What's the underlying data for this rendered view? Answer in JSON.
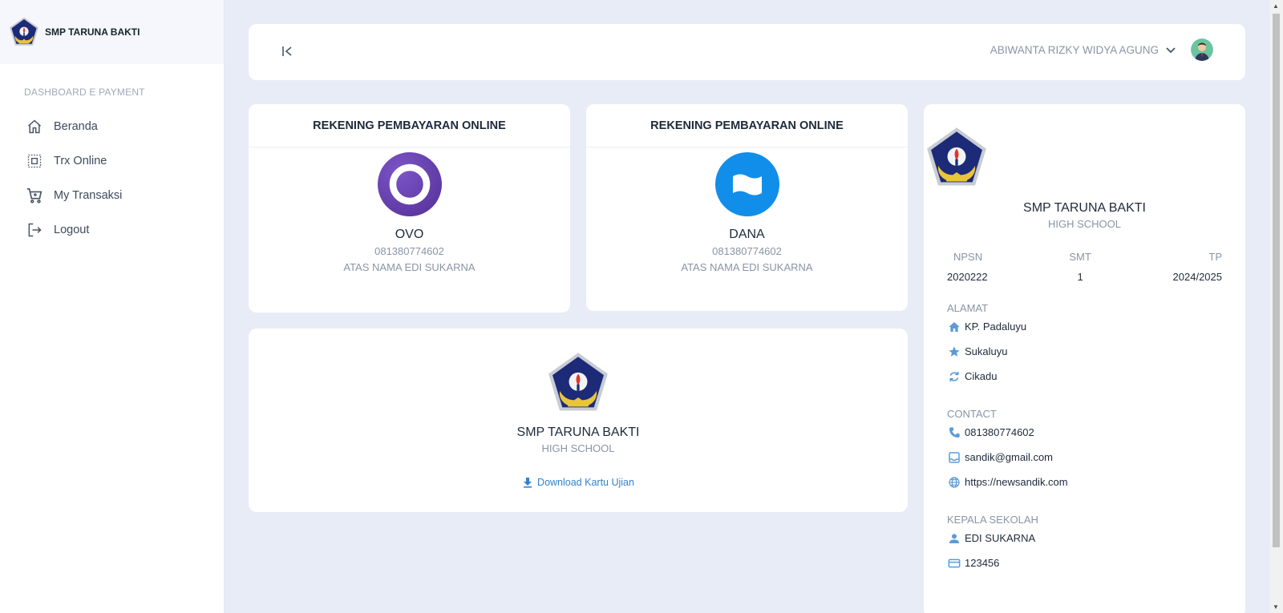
{
  "sidebar": {
    "brand": "SMP TARUNA BAKTI",
    "heading": "DASHBOARD E PAYMENT",
    "items": [
      {
        "label": "Beranda",
        "icon": "home-icon"
      },
      {
        "label": "Trx Online",
        "icon": "scan-icon"
      },
      {
        "label": "My Transaksi",
        "icon": "cart-icon"
      },
      {
        "label": "Logout",
        "icon": "logout-icon"
      }
    ]
  },
  "topbar": {
    "user_name": "ABIWANTA RIZKY WIDYA AGUNG",
    "collapse_icon": "collapse-sidebar-icon"
  },
  "payments": [
    {
      "title": "REKENING PEMBAYARAN ONLINE",
      "name": "OVO",
      "number": "081380774602",
      "holder": "ATAS NAMA EDI SUKARNA",
      "color": "#5f3aa4"
    },
    {
      "title": "REKENING PEMBAYARAN ONLINE",
      "name": "DANA",
      "number": "081380774602",
      "holder": "ATAS NAMA EDI SUKARNA",
      "color": "#118ee9"
    }
  ],
  "school_card": {
    "name": "SMP TARUNA BAKTI",
    "level": "HIGH SCHOOL",
    "download_label": "Download Kartu Ujian"
  },
  "profile": {
    "name": "SMP TARUNA BAKTI",
    "level": "HIGH SCHOOL",
    "stats": [
      {
        "label": "NPSN",
        "value": "2020222"
      },
      {
        "label": "SMT",
        "value": "1"
      },
      {
        "label": "TP",
        "value": "2024/2025"
      }
    ],
    "address_label": "ALAMAT",
    "address": [
      {
        "icon": "home-icon",
        "text": "KP. Padaluyu"
      },
      {
        "icon": "star-icon",
        "text": "Sukaluyu"
      },
      {
        "icon": "sync-icon",
        "text": "Cikadu"
      }
    ],
    "contact_label": "CONTACT",
    "contact": [
      {
        "icon": "phone-icon",
        "text": "081380774602"
      },
      {
        "icon": "inbox-icon",
        "text": "sandik@gmail.com"
      },
      {
        "icon": "globe-icon",
        "text": "https://newsandik.com"
      }
    ],
    "head_label": "KEPALA SEKOLAH",
    "head": [
      {
        "icon": "person-icon",
        "text": "EDI SUKARNA"
      },
      {
        "icon": "card-icon",
        "text": "123456"
      }
    ]
  },
  "colors": {
    "accent": "#3182ce",
    "icon_blue": "#5b9bd5",
    "background": "#e8ecf7"
  }
}
